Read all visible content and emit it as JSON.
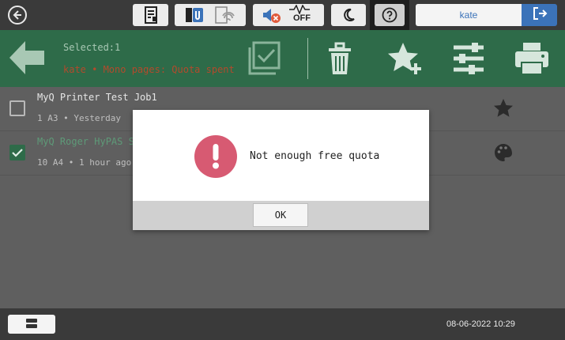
{
  "colors": {
    "action_bar": "#2e6b49",
    "accent_blue": "#3b73b9",
    "alert": "#d75a72"
  },
  "topbar": {
    "user": "kate",
    "eco_label": "OFF",
    "icons": [
      "back-icon",
      "toner-icon",
      "usb-icon",
      "wifi-icon",
      "speaker-muted-icon",
      "eco-off-icon",
      "sleep-moon-icon",
      "help-icon",
      "logout-icon"
    ]
  },
  "actionbar": {
    "selected": "Selected:1",
    "info": "kate • Mono pages: Quota spent"
  },
  "jobs": [
    {
      "title": "MyQ Printer Test Job1",
      "details": "1 A3 • Yesterday",
      "checked": false,
      "icon": "star-icon"
    },
    {
      "title": "MyQ Roger HyPAS S",
      "details": "10 A4 • 1 hour ago",
      "checked": true,
      "icon": "palette-icon"
    }
  ],
  "dialog": {
    "message": "Not enough free quota",
    "ok_label": "OK"
  },
  "footer": {
    "datetime": "08-06-2022 10:29"
  }
}
